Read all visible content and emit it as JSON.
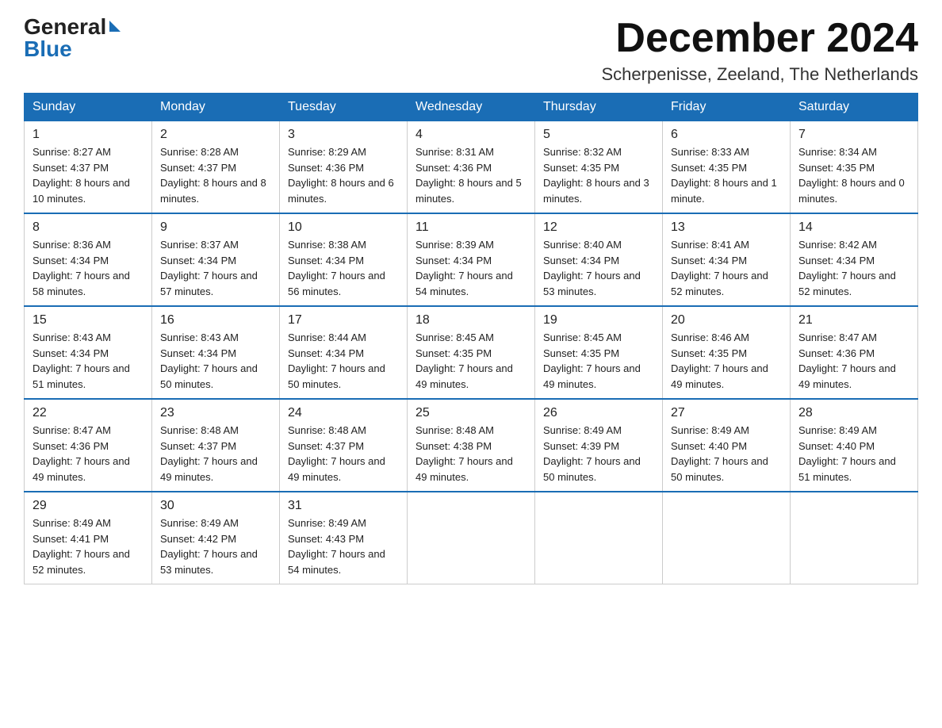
{
  "logo": {
    "general": "General",
    "blue": "Blue"
  },
  "header": {
    "month": "December 2024",
    "location": "Scherpenisse, Zeeland, The Netherlands"
  },
  "weekdays": [
    "Sunday",
    "Monday",
    "Tuesday",
    "Wednesday",
    "Thursday",
    "Friday",
    "Saturday"
  ],
  "weeks": [
    [
      {
        "day": "1",
        "sunrise": "8:27 AM",
        "sunset": "4:37 PM",
        "daylight": "8 hours and 10 minutes."
      },
      {
        "day": "2",
        "sunrise": "8:28 AM",
        "sunset": "4:37 PM",
        "daylight": "8 hours and 8 minutes."
      },
      {
        "day": "3",
        "sunrise": "8:29 AM",
        "sunset": "4:36 PM",
        "daylight": "8 hours and 6 minutes."
      },
      {
        "day": "4",
        "sunrise": "8:31 AM",
        "sunset": "4:36 PM",
        "daylight": "8 hours and 5 minutes."
      },
      {
        "day": "5",
        "sunrise": "8:32 AM",
        "sunset": "4:35 PM",
        "daylight": "8 hours and 3 minutes."
      },
      {
        "day": "6",
        "sunrise": "8:33 AM",
        "sunset": "4:35 PM",
        "daylight": "8 hours and 1 minute."
      },
      {
        "day": "7",
        "sunrise": "8:34 AM",
        "sunset": "4:35 PM",
        "daylight": "8 hours and 0 minutes."
      }
    ],
    [
      {
        "day": "8",
        "sunrise": "8:36 AM",
        "sunset": "4:34 PM",
        "daylight": "7 hours and 58 minutes."
      },
      {
        "day": "9",
        "sunrise": "8:37 AM",
        "sunset": "4:34 PM",
        "daylight": "7 hours and 57 minutes."
      },
      {
        "day": "10",
        "sunrise": "8:38 AM",
        "sunset": "4:34 PM",
        "daylight": "7 hours and 56 minutes."
      },
      {
        "day": "11",
        "sunrise": "8:39 AM",
        "sunset": "4:34 PM",
        "daylight": "7 hours and 54 minutes."
      },
      {
        "day": "12",
        "sunrise": "8:40 AM",
        "sunset": "4:34 PM",
        "daylight": "7 hours and 53 minutes."
      },
      {
        "day": "13",
        "sunrise": "8:41 AM",
        "sunset": "4:34 PM",
        "daylight": "7 hours and 52 minutes."
      },
      {
        "day": "14",
        "sunrise": "8:42 AM",
        "sunset": "4:34 PM",
        "daylight": "7 hours and 52 minutes."
      }
    ],
    [
      {
        "day": "15",
        "sunrise": "8:43 AM",
        "sunset": "4:34 PM",
        "daylight": "7 hours and 51 minutes."
      },
      {
        "day": "16",
        "sunrise": "8:43 AM",
        "sunset": "4:34 PM",
        "daylight": "7 hours and 50 minutes."
      },
      {
        "day": "17",
        "sunrise": "8:44 AM",
        "sunset": "4:34 PM",
        "daylight": "7 hours and 50 minutes."
      },
      {
        "day": "18",
        "sunrise": "8:45 AM",
        "sunset": "4:35 PM",
        "daylight": "7 hours and 49 minutes."
      },
      {
        "day": "19",
        "sunrise": "8:45 AM",
        "sunset": "4:35 PM",
        "daylight": "7 hours and 49 minutes."
      },
      {
        "day": "20",
        "sunrise": "8:46 AM",
        "sunset": "4:35 PM",
        "daylight": "7 hours and 49 minutes."
      },
      {
        "day": "21",
        "sunrise": "8:47 AM",
        "sunset": "4:36 PM",
        "daylight": "7 hours and 49 minutes."
      }
    ],
    [
      {
        "day": "22",
        "sunrise": "8:47 AM",
        "sunset": "4:36 PM",
        "daylight": "7 hours and 49 minutes."
      },
      {
        "day": "23",
        "sunrise": "8:48 AM",
        "sunset": "4:37 PM",
        "daylight": "7 hours and 49 minutes."
      },
      {
        "day": "24",
        "sunrise": "8:48 AM",
        "sunset": "4:37 PM",
        "daylight": "7 hours and 49 minutes."
      },
      {
        "day": "25",
        "sunrise": "8:48 AM",
        "sunset": "4:38 PM",
        "daylight": "7 hours and 49 minutes."
      },
      {
        "day": "26",
        "sunrise": "8:49 AM",
        "sunset": "4:39 PM",
        "daylight": "7 hours and 50 minutes."
      },
      {
        "day": "27",
        "sunrise": "8:49 AM",
        "sunset": "4:40 PM",
        "daylight": "7 hours and 50 minutes."
      },
      {
        "day": "28",
        "sunrise": "8:49 AM",
        "sunset": "4:40 PM",
        "daylight": "7 hours and 51 minutes."
      }
    ],
    [
      {
        "day": "29",
        "sunrise": "8:49 AM",
        "sunset": "4:41 PM",
        "daylight": "7 hours and 52 minutes."
      },
      {
        "day": "30",
        "sunrise": "8:49 AM",
        "sunset": "4:42 PM",
        "daylight": "7 hours and 53 minutes."
      },
      {
        "day": "31",
        "sunrise": "8:49 AM",
        "sunset": "4:43 PM",
        "daylight": "7 hours and 54 minutes."
      },
      null,
      null,
      null,
      null
    ]
  ],
  "labels": {
    "sunrise": "Sunrise:",
    "sunset": "Sunset:",
    "daylight": "Daylight:"
  }
}
